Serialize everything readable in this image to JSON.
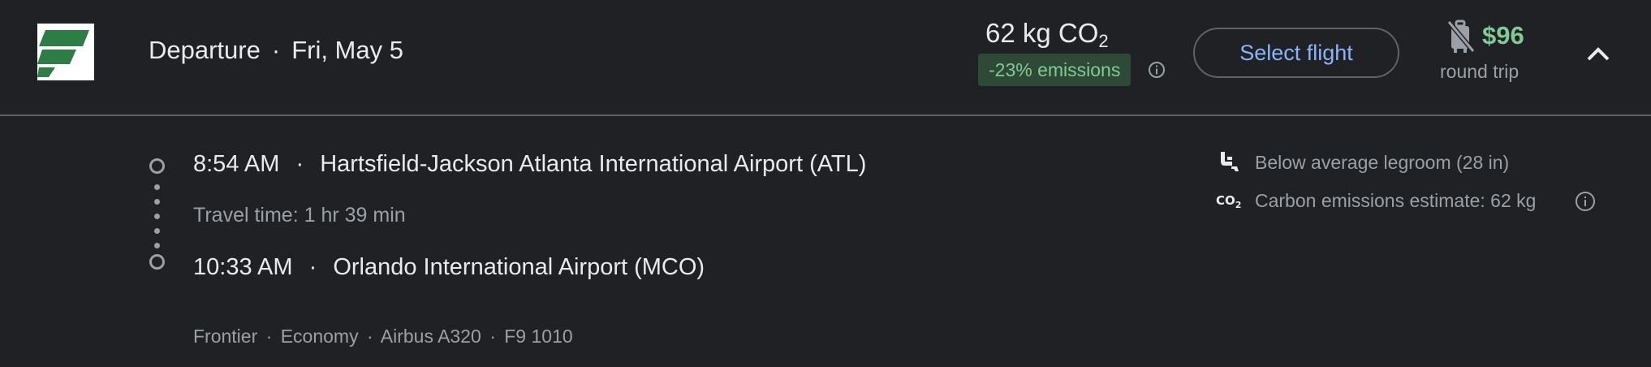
{
  "header": {
    "direction": "Departure",
    "separator": "·",
    "date": "Fri, May 5",
    "co2_value": "62 kg CO",
    "co2_sub": "2",
    "emissions_badge": "-23% emissions",
    "select_label": "Select flight",
    "price": "$96",
    "price_sub": "round trip"
  },
  "segment": {
    "departure_time": "8:54 AM",
    "departure_airport": "Hartsfield-Jackson Atlanta International Airport (ATL)",
    "travel_time": "Travel time: 1 hr 39 min",
    "arrival_time": "10:33 AM",
    "arrival_airport": "Orlando International Airport (MCO)",
    "separator": "·"
  },
  "details": {
    "airline": "Frontier",
    "cabin": "Economy",
    "aircraft": "Airbus A320",
    "flight_number": "F9 1010",
    "separator": "·"
  },
  "amenities": {
    "legroom": "Below average legroom (28 in)",
    "carbon": "Carbon emissions estimate: 62 kg",
    "co2_icon_text": "CO",
    "co2_icon_sub": "2"
  },
  "colors": {
    "background": "#202124",
    "text": "#e8eaed",
    "secondary": "#9aa0a6",
    "accent_blue": "#8ab4f8",
    "green": "#81c995",
    "badge_bg": "#2e4a36",
    "logo_green": "#2e7d46"
  },
  "icons": [
    "frontier-logo",
    "info-icon",
    "no-carry-on-bag-icon",
    "chevron-up-icon",
    "seat-legroom-icon",
    "co2-icon"
  ]
}
